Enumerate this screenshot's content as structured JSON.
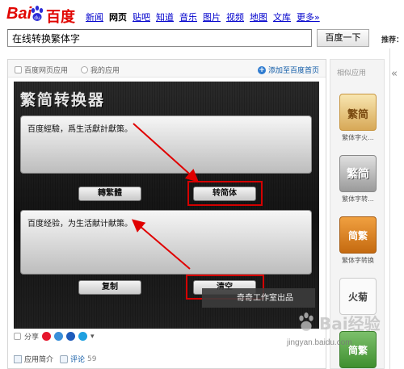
{
  "header": {
    "logo_latin": "Bai",
    "logo_cn": "百度",
    "nav": [
      "新闻",
      "网页",
      "贴吧",
      "知道",
      "音乐",
      "图片",
      "视频",
      "地图",
      "文库",
      "更多»"
    ],
    "active_nav_index": 1,
    "search_value": "在线转换繁体字",
    "search_button": "百度一下",
    "recommend_label": "推荐："
  },
  "app_panel": {
    "crumb_1": "百度网页应用",
    "crumb_2": "我的应用",
    "add_home": "添加至百度首页",
    "converter": {
      "title": "繁简转换器",
      "top_text": "百度經驗，爲生活獻計獻策。",
      "to_traditional": "轉繁體",
      "to_simplified": "转简体",
      "bottom_text": "百度经验，为生活献计献策。",
      "copy": "复制",
      "clear": "清空",
      "credit": "奇奇工作室出品"
    },
    "share_label": "分享",
    "tab_intro": "应用简介",
    "tab_comments": "评论",
    "comment_count": "59"
  },
  "sidebar": {
    "title": "相似应用",
    "apps": [
      {
        "thumb_text": "繁简",
        "label": "繁体字火..."
      },
      {
        "thumb_text": "繁简",
        "label": "繁体字转..."
      },
      {
        "thumb_text": "简繁",
        "label": "繁体字转换"
      },
      {
        "thumb_text": "火菊",
        "label": ""
      },
      {
        "thumb_text": "简繁",
        "label": ""
      }
    ],
    "collapse_icon": "double-chevron-left"
  },
  "watermark": {
    "main": "Bai经验",
    "sub": "jingyan.baidu.com"
  },
  "colors": {
    "baidu_red": "#e10602",
    "link_blue": "#0000cc",
    "highlight_red": "#d40000"
  }
}
